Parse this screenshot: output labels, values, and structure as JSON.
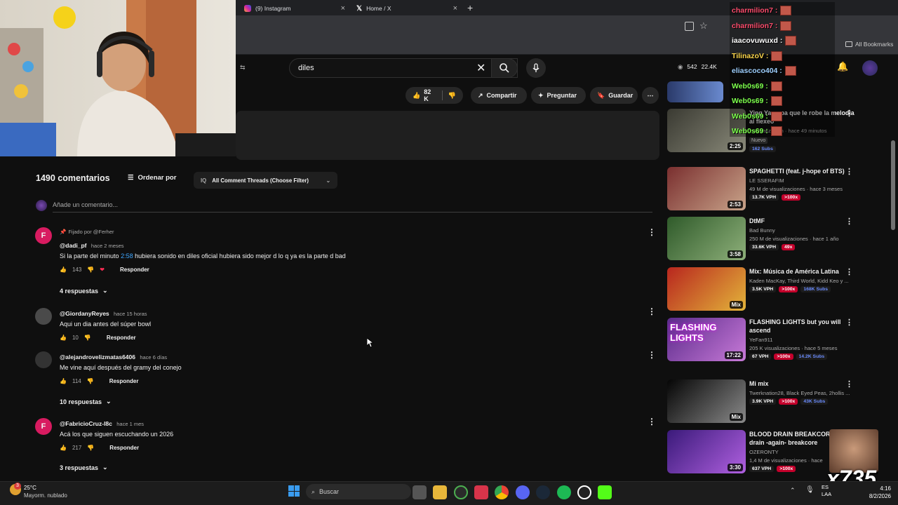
{
  "browser": {
    "tabs": [
      {
        "label": "(9) Instagram",
        "icon": "instagram-icon",
        "color": "#d6249f"
      },
      {
        "label": "Home / X",
        "icon": "x-icon",
        "color": "#ffffff"
      }
    ],
    "bookmarks_label": "All Bookmarks"
  },
  "youtube": {
    "search_query": "diles",
    "header_stats": {
      "viewers": "542",
      "likes": "22.4K"
    },
    "actions": {
      "like_count": "82 K",
      "share": "Compartir",
      "ask": "Preguntar",
      "save": "Guardar"
    },
    "comments_header": {
      "count": "1490 comentarios",
      "sort": "Ordenar por",
      "filter": "All Comment Threads (Choose Filter)",
      "add_placeholder": "Añade un comentario..."
    },
    "comments": [
      {
        "pinned_label": "Fijado por @Ferher",
        "avatar_letter": "F",
        "avatar_color": "#d81b60",
        "handle": "@dadi_pf",
        "time": "hace 2 meses",
        "text_pre": "Si la parte del minuto",
        "timestamp_link": "2:58",
        "text_post": "hubiera sonido en diles oficial hubiera sido mejor d lo q ya es la parte d bad",
        "likes": "143",
        "reply": "Responder",
        "replies": "4 respuestas"
      },
      {
        "avatar_letter": "",
        "avatar_color": "#4a4a4a",
        "handle": "@GiordanyReyes",
        "time": "hace 15 horas",
        "text": "Aqui un dia antes del súper bowl",
        "likes": "10",
        "reply": "Responder"
      },
      {
        "avatar_letter": "",
        "avatar_color": "#333333",
        "handle": "@alejandrovelizmatas6406",
        "time": "hace 6 días",
        "text": "Me vine aquí después del gramy del conejo",
        "likes": "114",
        "reply": "Responder",
        "replies": "10 respuestas"
      },
      {
        "avatar_letter": "F",
        "avatar_color": "#d81b60",
        "handle": "@FabricioCruz-l8c",
        "time": "hace 1 mes",
        "text": "Acá los que siguen escuchando un 2026",
        "likes": "217",
        "reply": "Responder",
        "replies": "3 respuestas"
      }
    ],
    "sidebar": [
      {
        "title": "Ying Yang pa que le robe la melodia al flexeo",
        "meta": "1 visualización · hace 49 minutos",
        "new_badge": "Nuevo",
        "subs": "162 Subs",
        "duration": "2:25",
        "colors": [
          "#3a3a32",
          "#8a8a7a"
        ]
      },
      {
        "title": "SPAGHETTI (feat. j-hope of BTS)",
        "channel": "LE SSERAFIM",
        "meta": "49 M de visualizaciones · hace 3 meses",
        "vph": "13.7K VPH",
        "badge": ">100x",
        "duration": "2:53",
        "colors": [
          "#7a2f2f",
          "#c9a48a"
        ]
      },
      {
        "title": "DtMF",
        "channel": "Bad Bunny",
        "meta": "250 M de visualizaciones · hace 1 año",
        "vph": "33.6K VPH",
        "badge": "49x",
        "duration": "3:58",
        "colors": [
          "#2f5a2a",
          "#8eb07a"
        ]
      },
      {
        "title": "Mix: Música de América Latina",
        "channel": "Kaden MacKay, Third World, Kidd Keo y ...",
        "vph": "3.5K VPH",
        "badge": ">100x",
        "subs": "168K Subs",
        "duration": "Mix",
        "colors": [
          "#b8261e",
          "#e3b43a"
        ]
      },
      {
        "title": "FLASHING LIGHTS but you will ascend",
        "channel": "YeFan911",
        "meta": "205 K visualizaciones · hace 5 meses",
        "vph": "67 VPH",
        "badge": ">100x",
        "subs": "14.2K Subs",
        "duration": "17:22",
        "thumb_text": "FLASHING LIGHTS",
        "colors": [
          "#5a2a8a",
          "#c87ad8"
        ]
      },
      {
        "title": "Mi mix",
        "channel": "Twerknation28, Black Eyed Peas, 2hollis ...",
        "vph": "3.9K VPH",
        "badge": ">100x",
        "subs": "43K Subs",
        "duration": "Mix",
        "colors": [
          "#050505",
          "#8a8a8a"
        ]
      },
      {
        "title": "BLOOD DRAIN BREAKCORE blood drain -again- breakcore",
        "channel": "OZERONTY",
        "meta": "1,4 M de visualizaciones · hace",
        "vph": "637 VPH",
        "badge": ">100x",
        "duration": "3:30",
        "colors": [
          "#3a1a7a",
          "#b060e0"
        ]
      }
    ]
  },
  "chat": [
    {
      "user": "charmilion7 :",
      "color": "#ff4d6d"
    },
    {
      "user": "charmilion7 :",
      "color": "#ff4d6d"
    },
    {
      "user": "iaacovuwuxd :",
      "color": "#ffffff"
    },
    {
      "user": "TilinazoV :",
      "color": "#ffd84d"
    },
    {
      "user": "eliascoco404 :",
      "color": "#9fd0ff"
    },
    {
      "user": "Web0s69 :",
      "color": "#7dff4d"
    },
    {
      "user": "Web0s69 :",
      "color": "#7dff4d"
    },
    {
      "user": "Web0s69 :",
      "color": "#7dff4d"
    },
    {
      "user": "Web0s69 :",
      "color": "#7dff4d"
    }
  ],
  "stream_overlay": {
    "label": "x735"
  },
  "taskbar": {
    "weather_temp": "25°C",
    "weather_desc": "Mayorm. nublado",
    "search_label": "Buscar",
    "notification_count": "3",
    "lang_top": "ES",
    "lang_bottom": "LAA",
    "time": "4:16",
    "date": "8/2/2026"
  }
}
